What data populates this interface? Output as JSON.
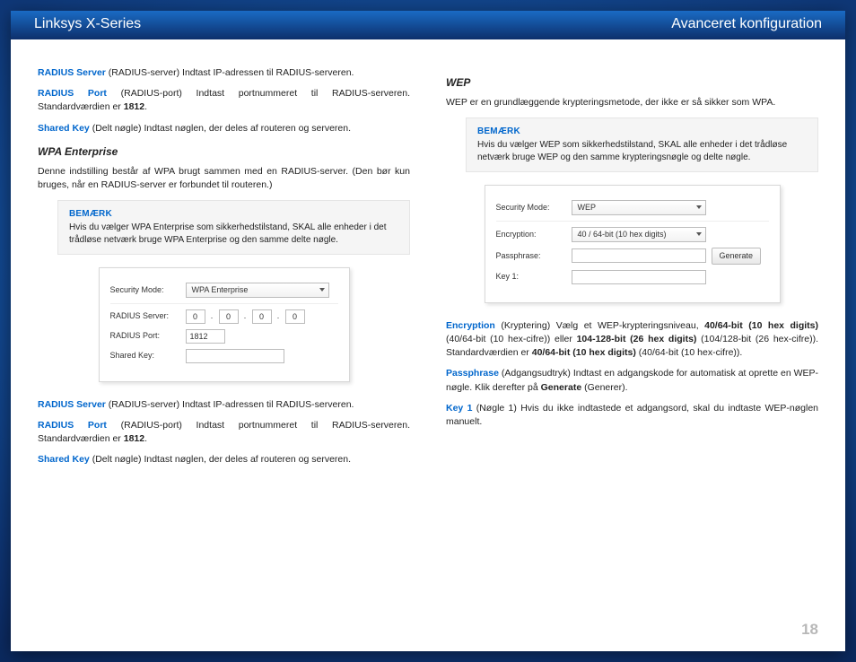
{
  "header": {
    "left": "Linksys X-Series",
    "right": "Avanceret konfiguration"
  },
  "left": {
    "p1": {
      "term": "RADIUS Server",
      "rest": " (RADIUS-server)  Indtast IP-adressen til RADIUS-serveren."
    },
    "p2": {
      "term": "RADIUS Port",
      "rest": " (RADIUS-port) Indtast portnummeret til RADIUS-serveren. Standardværdien er ",
      "bold": "1812",
      "tail": "."
    },
    "p3": {
      "term": "Shared Key",
      "rest": " (Delt nøgle)  Indtast nøglen, der deles af routeren og serveren."
    },
    "h1": "WPA Enterprise",
    "p4": "Denne indstilling består af WPA brugt sammen med en RADIUS-server. (Den bør kun bruges, når en RADIUS-server er forbundet til routeren.)",
    "note1": {
      "title": "BEMÆRK",
      "body": "Hvis du vælger WPA Enterprise som sikkerhedstilstand, SKAL alle enheder i det trådløse netværk bruge WPA Enterprise og den samme delte nøgle."
    },
    "panel1": {
      "securityModeLabel": "Security Mode:",
      "securityModeValue": "WPA Enterprise",
      "radiusServerLabel": "RADIUS Server:",
      "oct": [
        "0",
        "0",
        "0",
        "0"
      ],
      "radiusPortLabel": "RADIUS Port:",
      "radiusPortValue": "1812",
      "sharedKeyLabel": "Shared Key:",
      "sharedKeyValue": ""
    },
    "p5": {
      "term": "RADIUS Server",
      "rest": " (RADIUS-server)  Indtast IP-adressen til RADIUS-serveren."
    },
    "p6": {
      "term": "RADIUS Port",
      "rest": " (RADIUS-port) Indtast portnummeret til RADIUS-serveren. Standardværdien er ",
      "bold": "1812",
      "tail": "."
    },
    "p7": {
      "term": "Shared Key",
      "rest": " (Delt nøgle)  Indtast nøglen, der deles af routeren og serveren."
    }
  },
  "right": {
    "h1": "WEP",
    "p1": "WEP er en grundlæggende krypteringsmetode, der ikke er så sikker som WPA.",
    "note1": {
      "title": "BEMÆRK",
      "body": "Hvis du vælger WEP som sikkerhedstilstand, SKAL alle enheder i det trådløse netværk bruge WEP og den samme krypteringsnøgle og delte nøgle."
    },
    "panel1": {
      "securityModeLabel": "Security Mode:",
      "securityModeValue": "WEP",
      "encryptionLabel": "Encryption:",
      "encryptionValue": "40 / 64-bit (10 hex digits)",
      "passphraseLabel": "Passphrase:",
      "passphraseValue": "",
      "generateLabel": "Generate",
      "key1Label": "Key 1:",
      "key1Value": ""
    },
    "p2": {
      "term": "Encryption",
      "rest": " (Kryptering) Vælg et WEP-krypteringsniveau, ",
      "b1": "40/64-bit (10 hex digits)",
      "mid1": " (40/64-bit (10 hex-cifre)) eller ",
      "b2": "104-128-bit (26 hex digits)",
      "mid2": " (104/128-bit (26 hex-cifre)). Standardværdien er ",
      "b3": "40/64-bit (10 hex digits)",
      "tail": " (40/64-bit (10 hex-cifre))."
    },
    "p3": {
      "term": "Passphrase",
      "rest": " (Adgangsudtryk) Indtast en adgangskode for automatisk at oprette en WEP-nøgle. Klik derefter på ",
      "b1": "Generate",
      "tail": " (Generer)."
    },
    "p4": {
      "term": "Key 1",
      "rest": " (Nøgle 1)  Hvis du ikke indtastede et adgangsord, skal du indtaste WEP-nøglen manuelt."
    }
  },
  "pageNumber": "18"
}
